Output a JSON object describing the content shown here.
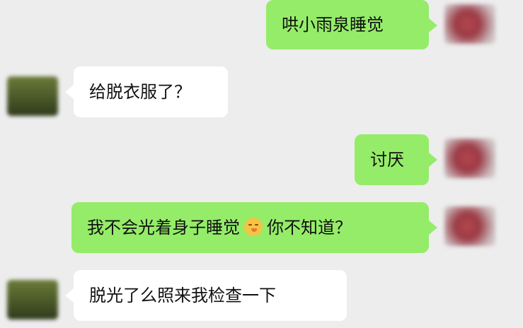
{
  "chat": {
    "messages": [
      {
        "sender": "self",
        "text": "哄小雨泉睡觉"
      },
      {
        "sender": "other",
        "text": "给脱衣服了？"
      },
      {
        "sender": "self",
        "text": "讨厌"
      },
      {
        "sender": "self",
        "text_before": "我不会光着身子睡觉",
        "emoji": "sleepy-face-emoji",
        "text_after": "你不知道？"
      },
      {
        "sender": "other",
        "text": "脱光了么照来我检查一下"
      }
    ]
  },
  "colors": {
    "background": "#ededed",
    "self_bubble": "#95ec69",
    "other_bubble": "#ffffff"
  }
}
